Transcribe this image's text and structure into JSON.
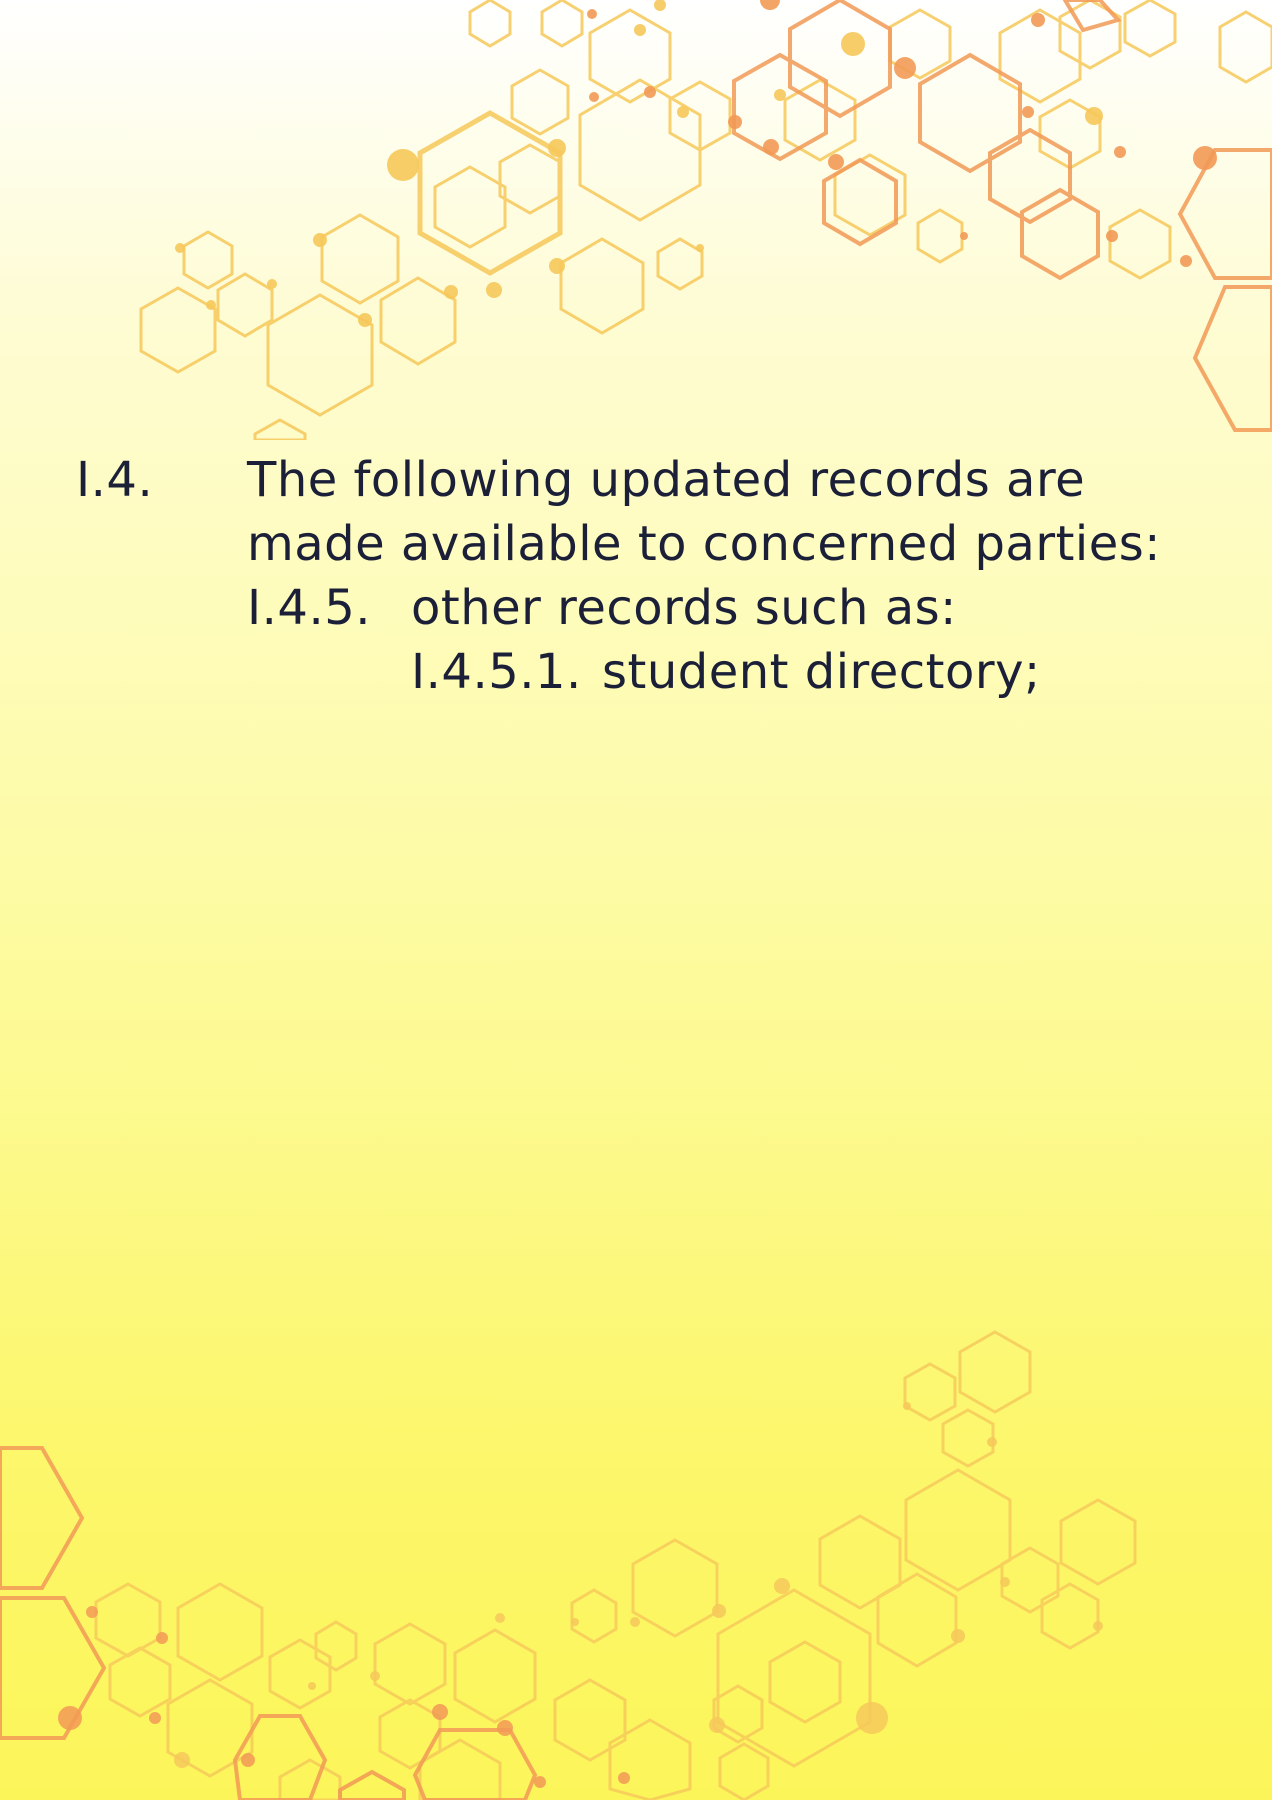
{
  "document": {
    "section": {
      "number": "I.4.",
      "text_line1": "The following updated records are",
      "text_line2": "made available to concerned parties:",
      "subsection": {
        "number": "I.4.5.",
        "text": "other records such as:",
        "item": {
          "number": "I.4.5.1.",
          "text": "student directory;"
        }
      }
    }
  },
  "colors": {
    "text": "#1b2038",
    "hex_light": "#f6c85a",
    "hex_orange": "#f29a56",
    "background_top": "#ffffff",
    "background_bottom": "#fcf55a"
  }
}
